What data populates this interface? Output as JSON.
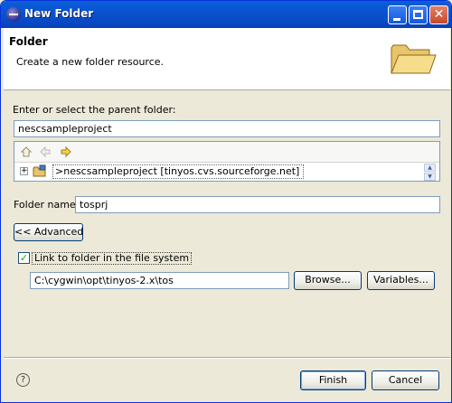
{
  "window": {
    "title": "New Folder"
  },
  "header": {
    "title": "Folder",
    "description": "Create a new folder resource."
  },
  "parent": {
    "label": "Enter or select the parent folder:",
    "value": "nescsampleproject",
    "tree_node": ">nescsampleproject  [tinyos.cvs.sourceforge.net]"
  },
  "folder_name": {
    "label": "Folder name:",
    "value": "tosprj"
  },
  "advanced_button": "<< Advanced",
  "link": {
    "checkbox_label": "Link to folder in the file system",
    "checked": true,
    "check_glyph": "✓",
    "path": "C:\\cygwin\\opt\\tinyos-2.x\\tos",
    "browse_button": "Browse...",
    "variables_button": "Variables..."
  },
  "footer": {
    "help_glyph": "?",
    "finish_button": "Finish",
    "cancel_button": "Cancel"
  },
  "icons": {
    "home": "home-icon",
    "back": "back-arrow-icon",
    "forward": "forward-arrow-icon",
    "expand": "plus-expand-icon",
    "project": "project-folder-icon",
    "folder": "open-folder-icon"
  },
  "colors": {
    "titlebar": "#0b53d0",
    "dialog_bg": "#ece9d8",
    "field_border": "#7f9db9"
  }
}
